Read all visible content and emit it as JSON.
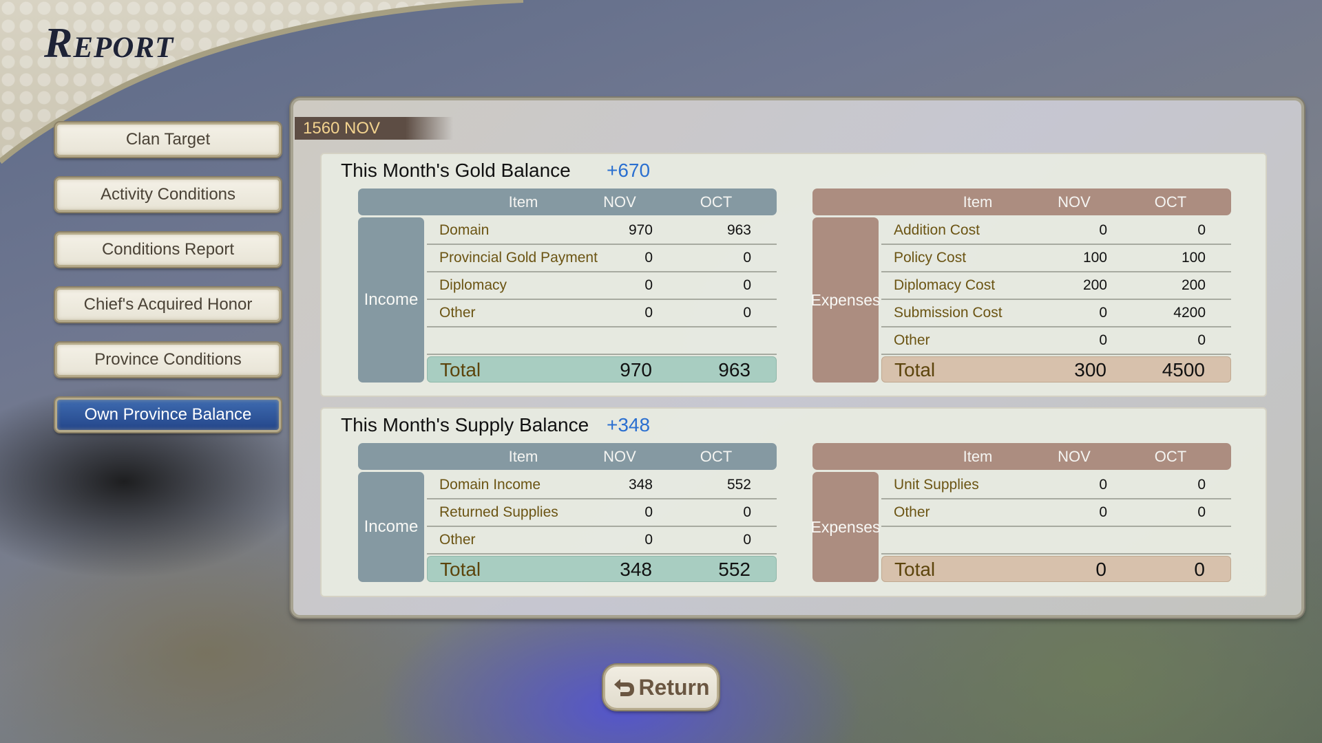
{
  "header": {
    "title": "Report"
  },
  "sidebar": {
    "items": [
      {
        "label": "Clan Target",
        "active": false
      },
      {
        "label": "Activity Conditions",
        "active": false
      },
      {
        "label": "Conditions Report",
        "active": false
      },
      {
        "label": "Chief's Acquired Honor",
        "active": false
      },
      {
        "label": "Province Conditions",
        "active": false
      },
      {
        "label": "Own Province Balance",
        "active": true
      }
    ]
  },
  "date": "1560 NOV",
  "gold": {
    "title": "This Month's Gold Balance",
    "delta": "+670",
    "income": {
      "label": "Income",
      "headers": {
        "item": "Item",
        "nov": "NOV",
        "oct": "OCT"
      },
      "rows": [
        {
          "name": "Domain",
          "nov": "970",
          "oct": "963"
        },
        {
          "name": "Provincial Gold Payment",
          "nov": "0",
          "oct": "0"
        },
        {
          "name": "Diplomacy",
          "nov": "0",
          "oct": "0"
        },
        {
          "name": "Other",
          "nov": "0",
          "oct": "0"
        },
        {
          "name": "",
          "nov": "",
          "oct": ""
        }
      ],
      "total": {
        "name": "Total",
        "nov": "970",
        "oct": "963"
      }
    },
    "expenses": {
      "label": "Expenses",
      "headers": {
        "item": "Item",
        "nov": "NOV",
        "oct": "OCT"
      },
      "rows": [
        {
          "name": "Addition Cost",
          "nov": "0",
          "oct": "0"
        },
        {
          "name": "Policy Cost",
          "nov": "100",
          "oct": "100"
        },
        {
          "name": "Diplomacy Cost",
          "nov": "200",
          "oct": "200"
        },
        {
          "name": "Submission Cost",
          "nov": "0",
          "oct": "4200"
        },
        {
          "name": "Other",
          "nov": "0",
          "oct": "0"
        }
      ],
      "total": {
        "name": "Total",
        "nov": "300",
        "oct": "4500"
      }
    }
  },
  "supply": {
    "title": "This Month's Supply Balance",
    "delta": "+348",
    "income": {
      "label": "Income",
      "headers": {
        "item": "Item",
        "nov": "NOV",
        "oct": "OCT"
      },
      "rows": [
        {
          "name": "Domain Income",
          "nov": "348",
          "oct": "552"
        },
        {
          "name": "Returned Supplies",
          "nov": "0",
          "oct": "0"
        },
        {
          "name": "Other",
          "nov": "0",
          "oct": "0"
        }
      ],
      "total": {
        "name": "Total",
        "nov": "348",
        "oct": "552"
      }
    },
    "expenses": {
      "label": "Expenses",
      "headers": {
        "item": "Item",
        "nov": "NOV",
        "oct": "OCT"
      },
      "rows": [
        {
          "name": "Unit Supplies",
          "nov": "0",
          "oct": "0"
        },
        {
          "name": "Other",
          "nov": "0",
          "oct": "0"
        },
        {
          "name": "",
          "nov": "",
          "oct": ""
        }
      ],
      "total": {
        "name": "Total",
        "nov": "0",
        "oct": "0"
      }
    }
  },
  "footer": {
    "return_label": "Return",
    "return_icon": "return-arrow-icon"
  },
  "colors": {
    "accent_blue": "#2a6fd0",
    "active_button": "#2f55a0",
    "income_header": "#8599a2",
    "expense_header": "#ac8d80",
    "income_total": "#a8cdc1",
    "expense_total": "#d7c1ac",
    "date_text": "#f3d38f"
  }
}
